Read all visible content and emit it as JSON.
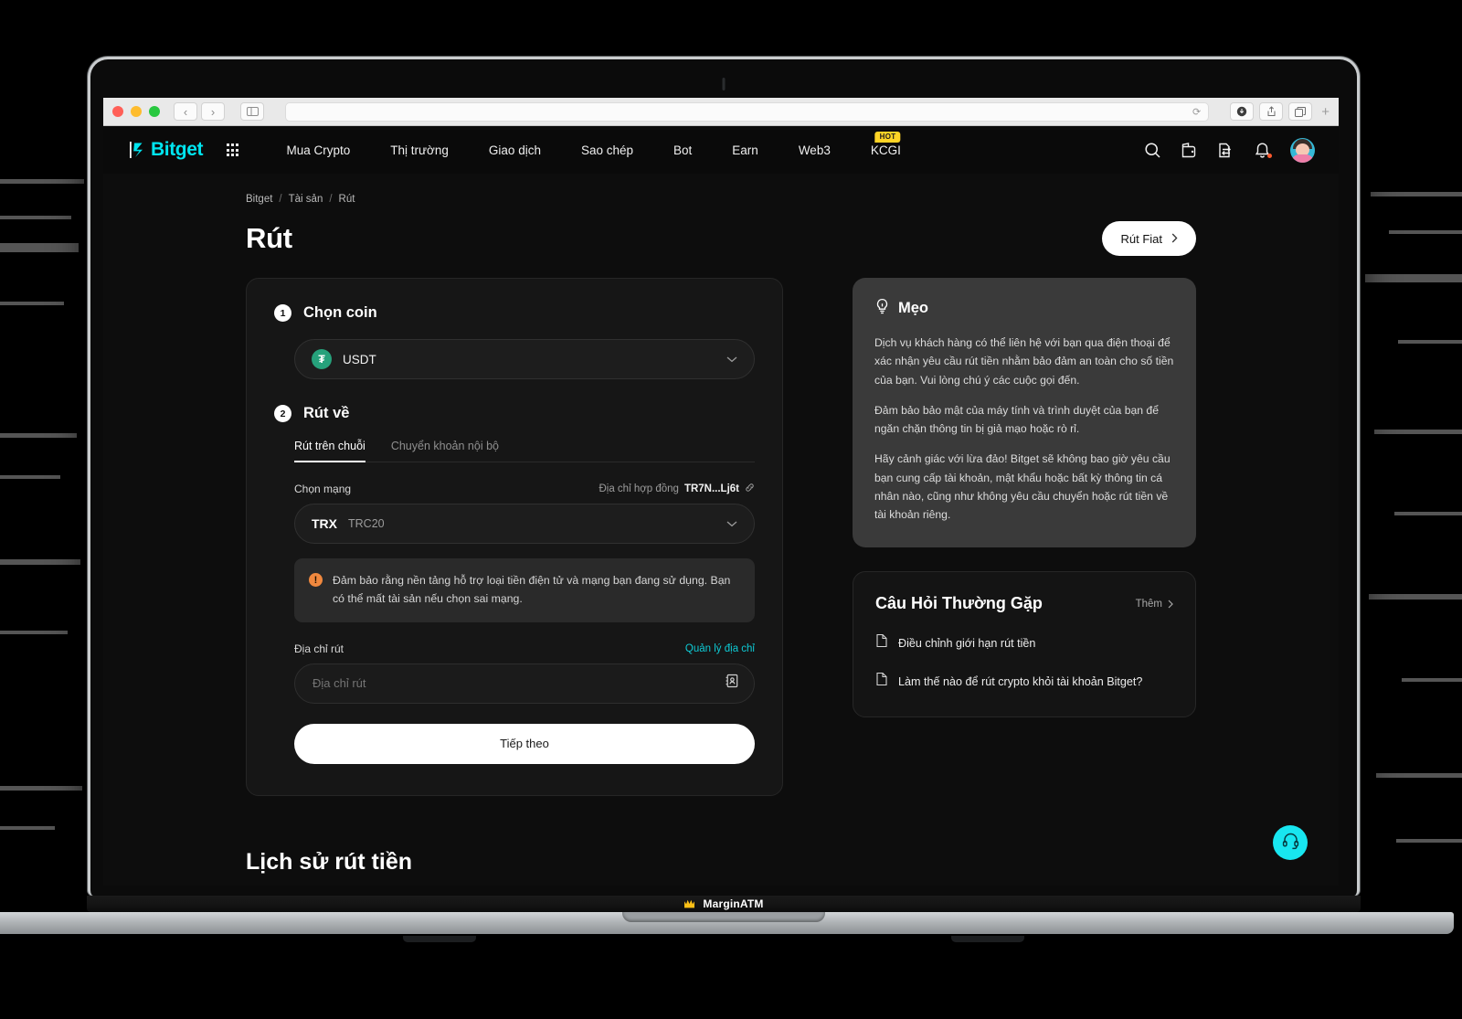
{
  "browser": {
    "traffic_lights": [
      "close",
      "minimize",
      "maximize"
    ],
    "back_icon": "‹",
    "forward_icon": "›",
    "sidebar_icon": "sidebar",
    "url_value": "",
    "reload_icon": "⟳",
    "download_icon": "download",
    "share_icon": "share",
    "tabs_icon": "tabs",
    "newtab_icon": "+"
  },
  "topnav": {
    "logo_text": "Bitget",
    "apps_icon": "grid-icon",
    "links": [
      {
        "label": "Mua Crypto",
        "badge": ""
      },
      {
        "label": "Thị trường",
        "badge": ""
      },
      {
        "label": "Giao dịch",
        "badge": ""
      },
      {
        "label": "Sao chép",
        "badge": ""
      },
      {
        "label": "Bot",
        "badge": ""
      },
      {
        "label": "Earn",
        "badge": ""
      },
      {
        "label": "Web3",
        "badge": ""
      },
      {
        "label": "KCGI",
        "badge": "HOT"
      }
    ],
    "icons": [
      "search-icon",
      "wallet-icon",
      "orders-icon",
      "notification-icon"
    ],
    "avatar": "user-avatar"
  },
  "breadcrumb": {
    "items": [
      "Bitget",
      "Tài sản",
      "Rút"
    ],
    "separator": "/"
  },
  "header": {
    "title": "Rút",
    "fiat_button": "Rút Fiat",
    "fiat_button_chevron": "›"
  },
  "form": {
    "step1": {
      "number": "1",
      "title": "Chọn coin"
    },
    "coin": {
      "symbol": "USDT",
      "icon_glyph": "₮",
      "icon_color": "#26a17b",
      "chevron": "⌄"
    },
    "step2": {
      "number": "2",
      "title": "Rút về"
    },
    "tabs": [
      {
        "label": "Rút trên chuỗi",
        "active": true
      },
      {
        "label": "Chuyển khoản nội bộ",
        "active": false
      }
    ],
    "network": {
      "label": "Chọn mạng",
      "contract_label": "Địa chỉ hợp đồng",
      "contract_value": "TR7N...Lj6t",
      "link_icon": "external-link-icon",
      "selected_main": "TRX",
      "selected_sub": "TRC20",
      "chevron": "⌄"
    },
    "warning": {
      "icon": "!",
      "text": "Đảm bảo rằng nền tảng hỗ trợ loại tiền điện tử và mạng bạn đang sử dụng. Bạn có thể mất tài sản nếu chọn sai mạng."
    },
    "address": {
      "label": "Địa chỉ rút",
      "manage_link": "Quản lý địa chỉ",
      "placeholder": "Địa chỉ rút",
      "value": "",
      "book_icon": "address-book-icon"
    },
    "submit_label": "Tiếp theo"
  },
  "tips": {
    "icon": "lightbulb-icon",
    "title": "Mẹo",
    "paragraphs": [
      "Dịch vụ khách hàng có thể liên hệ với bạn qua điện thoại để xác nhận yêu cầu rút tiền nhằm bảo đảm an toàn cho số tiền của bạn. Vui lòng chú ý các cuộc gọi đến.",
      "Đảm bảo bảo mật của máy tính và trình duyệt của bạn để ngăn chặn thông tin bị giả mạo hoặc rò rỉ.",
      "Hãy cảnh giác với lừa đảo! Bitget sẽ không bao giờ yêu cầu bạn cung cấp tài khoản, mật khẩu hoặc bất kỳ thông tin cá nhân nào, cũng như không yêu cầu chuyển hoặc rút tiền về tài khoản riêng."
    ]
  },
  "faq": {
    "title": "Câu Hỏi Thường Gặp",
    "more_label": "Thêm",
    "more_chevron": "›",
    "items": [
      {
        "icon": "document-icon",
        "label": "Điều chỉnh giới hạn rút tiền"
      },
      {
        "icon": "document-icon",
        "label": "Làm thế nào để rút crypto khỏi tài khoản Bitget?"
      }
    ]
  },
  "history": {
    "title": "Lịch sử rút tiền"
  },
  "support": {
    "icon": "headset-icon",
    "color": "#18e6f0"
  },
  "watermark": {
    "crown_icon": "crown-icon",
    "text": "MarginATM"
  },
  "colors": {
    "accent": "#00e5f0",
    "page_bg": "#0d0d0d",
    "card_bg": "#161616",
    "tip_bg": "#3a3a3a",
    "link": "#0ecad4",
    "warning": "#f0883e",
    "hot_badge": "#ffd426",
    "usdt_green": "#26a17b"
  }
}
